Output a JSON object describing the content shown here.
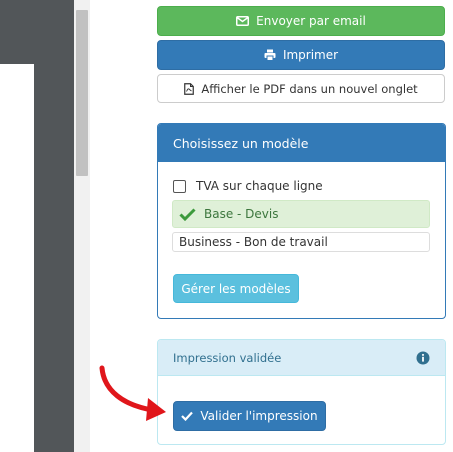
{
  "actions": {
    "email_label": "Envoyer par email",
    "print_label": "Imprimer",
    "pdf_label": "Afficher le PDF dans un nouvel onglet"
  },
  "model_panel": {
    "title": "Choisissez un modèle",
    "vat_checkbox_label": "TVA sur chaque ligne",
    "vat_checked": false,
    "models": [
      {
        "label": "Base - Devis",
        "selected": true
      },
      {
        "label": "Business - Bon de travail",
        "selected": false
      }
    ],
    "manage_label": "Gérer les modèles"
  },
  "validation_panel": {
    "title": "Impression validée",
    "validate_label": "Valider l'impression"
  },
  "colors": {
    "success": "#5cb85c",
    "primary": "#337ab7",
    "info": "#5bc0de",
    "annotation": "#e0161b"
  },
  "icons": {
    "email": "envelope-icon",
    "print": "printer-icon",
    "pdf": "file-pdf-icon",
    "selected_model": "check-icon",
    "info": "info-circle-icon",
    "validate": "check-icon"
  }
}
